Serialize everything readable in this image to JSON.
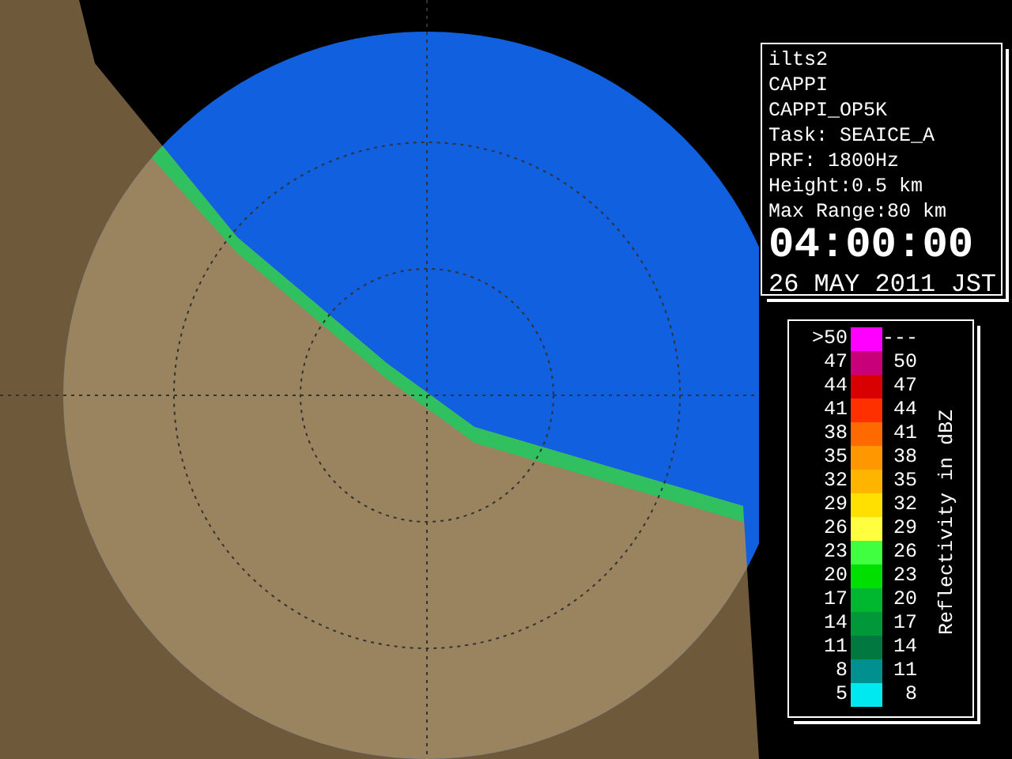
{
  "info_panel": {
    "lines": [
      "ilts2",
      "CAPPI",
      "CAPPI_OP5K",
      "Task: SEAICE_A",
      "PRF: 1800Hz",
      "Height:0.5 km",
      "Max Range:80 km"
    ],
    "time": "04:00:00",
    "date": "26 MAY 2011 JST"
  },
  "legend": {
    "title": "Reflectivity in dBZ",
    "rows": [
      {
        "low": ">50",
        "high": "---",
        "color": "#ff00ff"
      },
      {
        "low": "47",
        "high": "50",
        "color": "#c8007a"
      },
      {
        "low": "44",
        "high": "47",
        "color": "#d80000"
      },
      {
        "low": "41",
        "high": "44",
        "color": "#ff3000"
      },
      {
        "low": "38",
        "high": "41",
        "color": "#ff6a00"
      },
      {
        "low": "35",
        "high": "38",
        "color": "#ff9800"
      },
      {
        "low": "32",
        "high": "35",
        "color": "#ffb400"
      },
      {
        "low": "29",
        "high": "32",
        "color": "#ffe000"
      },
      {
        "low": "26",
        "high": "29",
        "color": "#ffff40"
      },
      {
        "low": "23",
        "high": "26",
        "color": "#40ff40"
      },
      {
        "low": "20",
        "high": "23",
        "color": "#00e000"
      },
      {
        "low": "17",
        "high": "20",
        "color": "#00b830"
      },
      {
        "low": "14",
        "high": "17",
        "color": "#009838"
      },
      {
        "low": "11",
        "high": "14",
        "color": "#007840"
      },
      {
        "low": "8",
        "high": "11",
        "color": "#009090"
      },
      {
        "low": "5",
        "high": "8",
        "color": "#00e8f0"
      }
    ]
  }
}
